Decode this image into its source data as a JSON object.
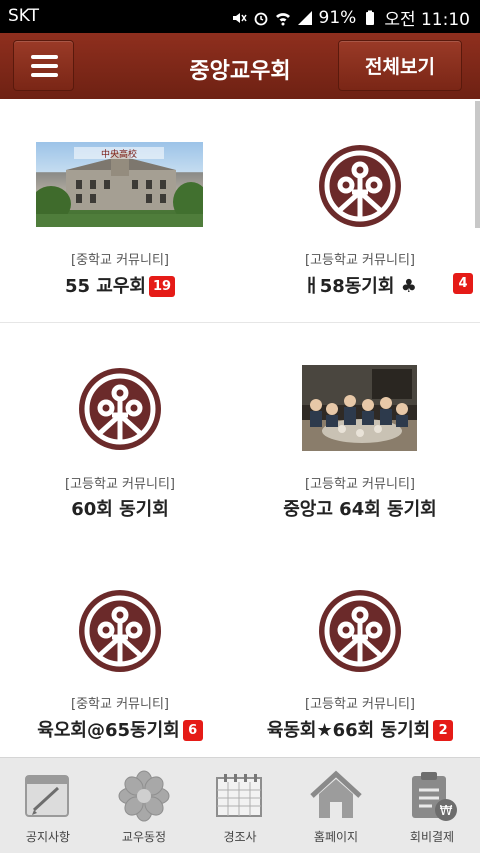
{
  "status": {
    "carrier": "SKT",
    "battery": "91%",
    "time": "오전 11:10"
  },
  "header": {
    "title": "중앙교우회",
    "view_all_label": "전체보기",
    "menu_icon": "hamburger-icon"
  },
  "communities": [
    {
      "category": "[중학교 커뮤니티]",
      "name": "55 교우회",
      "badge": "19",
      "thumb": "school-building-photo"
    },
    {
      "category": "[고등학교 커뮤니티]",
      "name": "ㅐ58동기회 ♣",
      "badge": "4",
      "thumb": "school-emblem"
    },
    {
      "category": "[고등학교 커뮤니티]",
      "name": "60회 동기회",
      "badge": "",
      "thumb": "school-emblem"
    },
    {
      "category": "[고등학교 커뮤니티]",
      "name": "중앙고 64회 동기회",
      "badge": "",
      "thumb": "group-dinner-photo"
    },
    {
      "category": "[중학교 커뮤니티]",
      "name": "육오회@65동기회",
      "badge": "6",
      "thumb": "school-emblem"
    },
    {
      "category": "[고등학교 커뮤니티]",
      "name": "육동회★66회 동기회",
      "badge": "2",
      "thumb": "school-emblem"
    }
  ],
  "nav": [
    {
      "label": "공지사항",
      "icon": "notepad-icon"
    },
    {
      "label": "교우동정",
      "icon": "flower-icon"
    },
    {
      "label": "경조사",
      "icon": "calendar-icon"
    },
    {
      "label": "홈페이지",
      "icon": "home-icon"
    },
    {
      "label": "회비결제",
      "icon": "payment-clipboard-icon"
    }
  ],
  "colors": {
    "header_brand": "#7e2817",
    "emblem": "#6b2a2a",
    "badge": "#e51b17"
  }
}
